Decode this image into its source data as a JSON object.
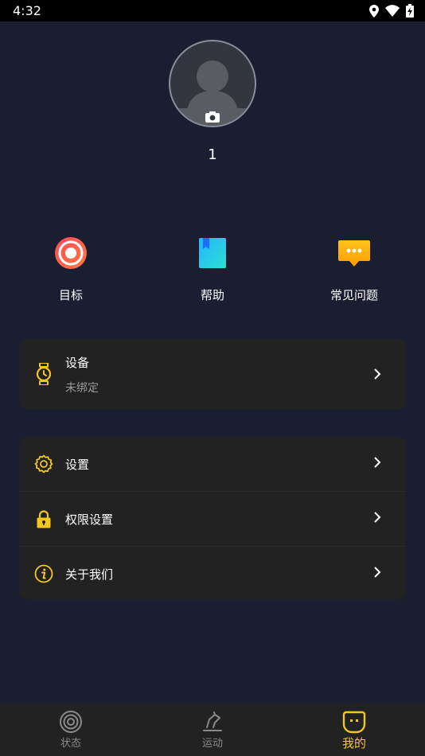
{
  "status_bar": {
    "time": "4:32"
  },
  "profile": {
    "username": "1"
  },
  "quick_actions": [
    {
      "label": "目标",
      "icon": "target-icon"
    },
    {
      "label": "帮助",
      "icon": "book-icon"
    },
    {
      "label": "常见问题",
      "icon": "chat-bubble-icon"
    }
  ],
  "device_card": {
    "title": "设备",
    "subtitle": "未绑定",
    "icon": "watch-icon"
  },
  "menu": [
    {
      "label": "设置",
      "icon": "gear-icon"
    },
    {
      "label": "权限设置",
      "icon": "lock-icon"
    },
    {
      "label": "关于我们",
      "icon": "info-icon"
    }
  ],
  "tabs": [
    {
      "label": "状态",
      "icon": "status-rings-icon",
      "active": false
    },
    {
      "label": "运动",
      "icon": "running-icon",
      "active": false
    },
    {
      "label": "我的",
      "icon": "smiley-icon",
      "active": true
    }
  ],
  "colors": {
    "accent": "#f3c622",
    "background": "#1b1d31",
    "card": "#222222"
  }
}
